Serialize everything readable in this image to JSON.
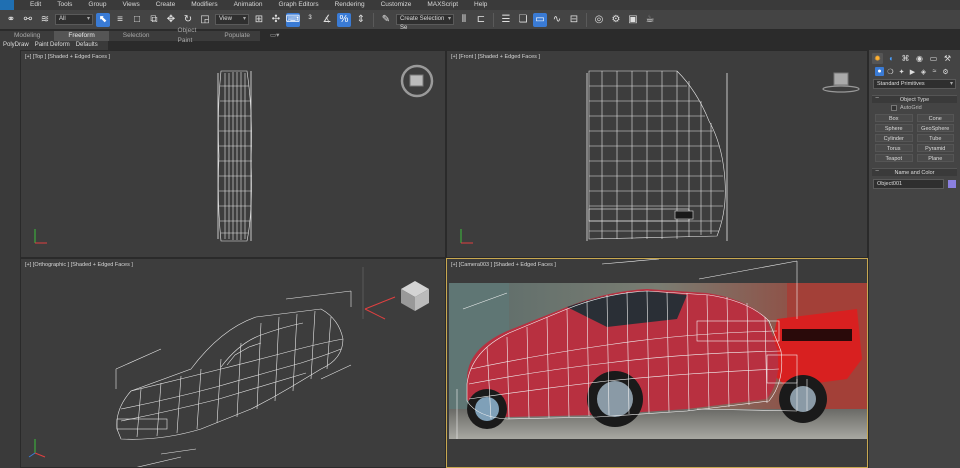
{
  "menu": [
    "Edit",
    "Tools",
    "Group",
    "Views",
    "Create",
    "Modifiers",
    "Animation",
    "Graph Editors",
    "Rendering",
    "Customize",
    "MAXScript",
    "Help"
  ],
  "toolbar": {
    "filter_value": "All",
    "refcoord_value": "View",
    "named_selection_placeholder": "Create Selection Se"
  },
  "ribbon": {
    "tabs": [
      "Modeling",
      "Freeform",
      "Selection",
      "Object Paint",
      "Populate"
    ],
    "selected_tab": "Freeform",
    "subtabs": [
      "PolyDraw",
      "Paint Deform",
      "Defaults"
    ]
  },
  "viewports": {
    "top": "[+] [Top ] [Shaded + Edged Faces ]",
    "front": "[+] [Front ] [Shaded + Edged Faces ]",
    "ortho": "[+] [Orthographic ] [Shaded + Edged Faces ]",
    "camera": "[+] [Camera003 ] [Shaded + Edged Faces ]"
  },
  "command_panel": {
    "category_dropdown": "Standard Primitives",
    "object_type_title": "Object Type",
    "autogrid_label": "AutoGrid",
    "primitives": [
      "Box",
      "Cone",
      "Sphere",
      "GeoSphere",
      "Cylinder",
      "Tube",
      "Torus",
      "Pyramid",
      "Teapot",
      "Plane"
    ],
    "name_color_title": "Name and Color",
    "object_name": "Object001",
    "object_color": "#8a7fe0"
  },
  "colors": {
    "accent": "#3a7bd5",
    "active_viewport_border": "#c8a850",
    "viewport_bg": "#3d3d3d"
  }
}
